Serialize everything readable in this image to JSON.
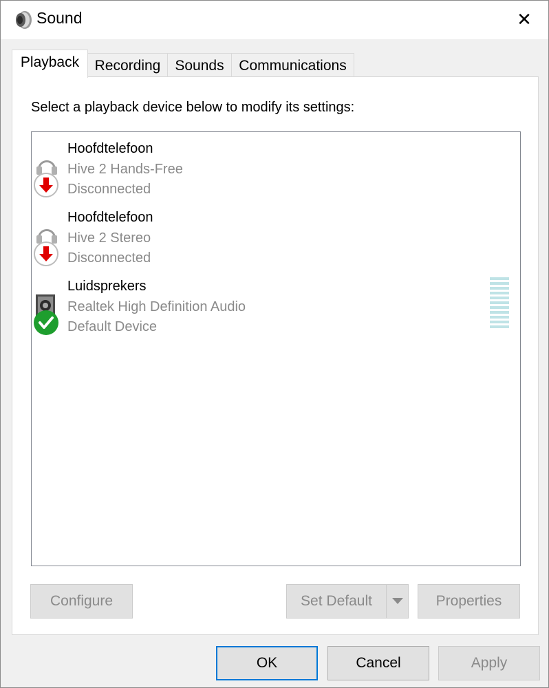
{
  "window": {
    "title": "Sound",
    "icon": "speaker-icon",
    "close_glyph": "✕"
  },
  "tabs": [
    {
      "label": "Playback",
      "active": true
    },
    {
      "label": "Recording",
      "active": false
    },
    {
      "label": "Sounds",
      "active": false
    },
    {
      "label": "Communications",
      "active": false
    }
  ],
  "panel": {
    "instruction": "Select a playback device below to modify its settings:",
    "devices": [
      {
        "name": "Hoofdtelefoon",
        "description": "Hive 2 Hands-Free",
        "status": "Disconnected",
        "icon": "headphones-icon",
        "badge": "disconnected-badge-icon"
      },
      {
        "name": "Hoofdtelefoon",
        "description": "Hive 2 Stereo",
        "status": "Disconnected",
        "icon": "headphones-icon",
        "badge": "disconnected-badge-icon"
      },
      {
        "name": "Luidsprekers",
        "description": "Realtek High Definition Audio",
        "status": "Default Device",
        "icon": "speaker-icon",
        "badge": "default-check-badge-icon"
      }
    ],
    "level_meter": {
      "level": 0
    }
  },
  "buttons": {
    "configure": "Configure",
    "set_default": "Set Default",
    "properties": "Properties",
    "ok": "OK",
    "cancel": "Cancel",
    "apply": "Apply"
  },
  "colors": {
    "accent": "#0078d7",
    "disabled_text": "#8a8a8a",
    "meter": "#bfe3e6",
    "disconnected_badge": "#e00000",
    "default_badge": "#1e9e2e"
  }
}
